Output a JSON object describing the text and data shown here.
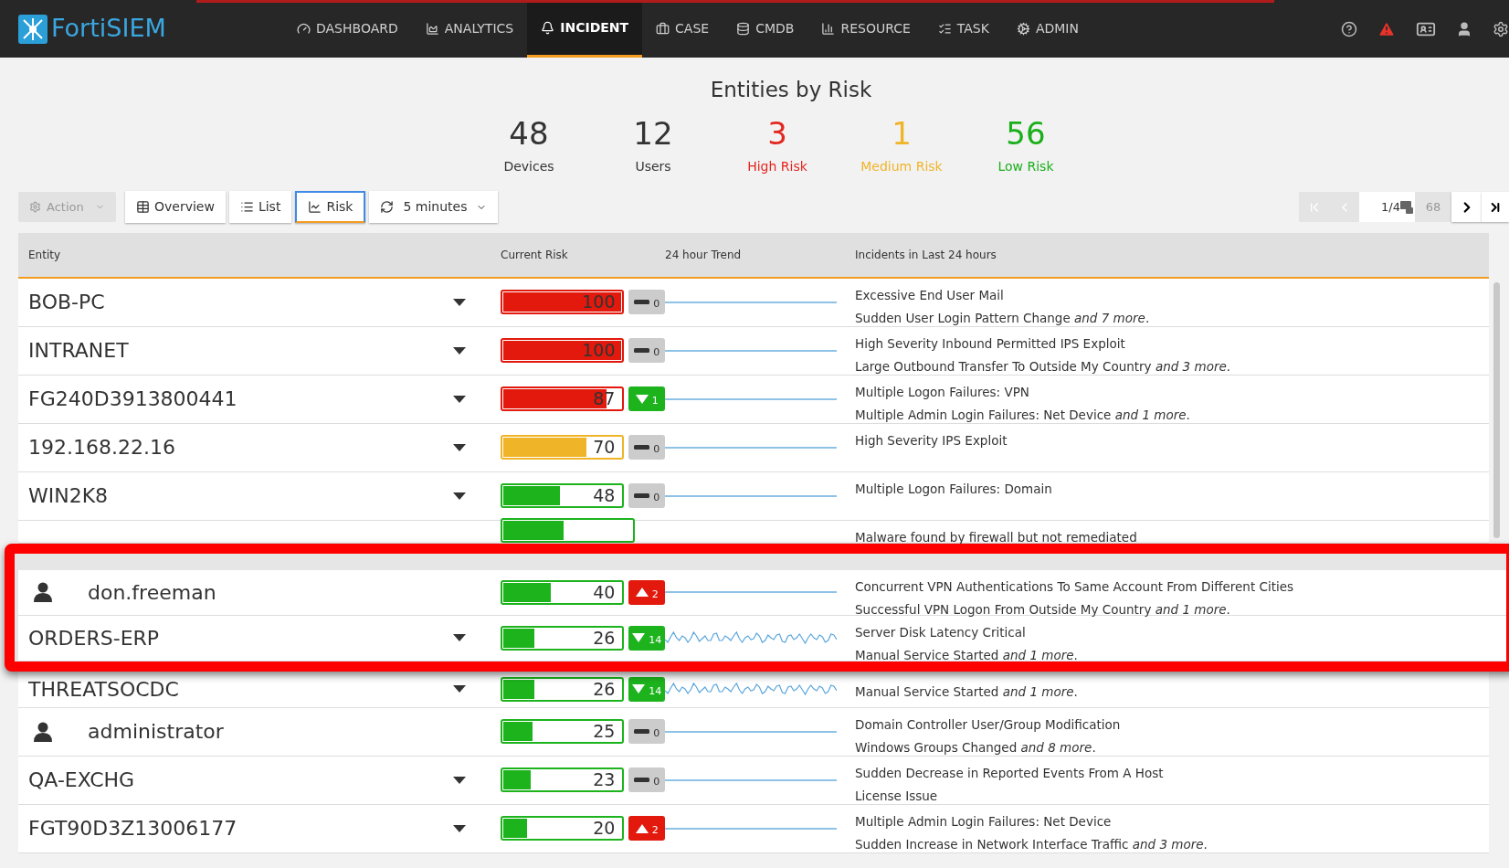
{
  "app": {
    "logo": "FortiSIEM"
  },
  "nav": [
    {
      "label": "DASHBOARD",
      "selected": false
    },
    {
      "label": "ANALYTICS",
      "selected": false
    },
    {
      "label": "INCIDENT",
      "selected": true
    },
    {
      "label": "CASE",
      "selected": false
    },
    {
      "label": "CMDB",
      "selected": false
    },
    {
      "label": "RESOURCE",
      "selected": false
    },
    {
      "label": "TASK",
      "selected": false
    },
    {
      "label": "ADMIN",
      "selected": false
    }
  ],
  "page_title": "Entities by Risk",
  "stats": [
    {
      "value": "48",
      "label": "Devices",
      "color": "#333333"
    },
    {
      "value": "12",
      "label": "Users",
      "color": "#333333"
    },
    {
      "value": "3",
      "label": "High Risk",
      "color": "#e3261f"
    },
    {
      "value": "1",
      "label": "Medium Risk",
      "color": "#f0b429"
    },
    {
      "value": "56",
      "label": "Low Risk",
      "color": "#1aaf1a"
    }
  ],
  "toolbar": {
    "action": {
      "label": "Action",
      "disabled": true
    },
    "views": [
      {
        "label": "Overview",
        "selected": false
      },
      {
        "label": "List",
        "selected": false
      },
      {
        "label": "Risk",
        "selected": true
      }
    ],
    "refresh": "5 minutes"
  },
  "pagination": {
    "page": "1/4",
    "total": "68",
    "first_disabled": true,
    "prev_disabled": true
  },
  "table": {
    "columns": [
      "Entity",
      "Current Risk",
      "24 hour Trend",
      "Incidents in Last 24 hours"
    ],
    "rows": [
      {
        "kind": "device",
        "name": "BOB-PC",
        "risk": {
          "text": "100",
          "level": 1.0,
          "color": "#e2190c"
        },
        "change": {
          "kind": "flat",
          "text": "0"
        },
        "sparkline": {
          "kind": "flat"
        },
        "incidents": [
          "Excessive End User Mail",
          "Sudden User Login Pattern Change *and 7 more*."
        ]
      },
      {
        "kind": "device",
        "name": "INTRANET",
        "risk": {
          "text": "100",
          "level": 1.0,
          "color": "#e2190c"
        },
        "change": {
          "kind": "flat",
          "text": "0"
        },
        "sparkline": {
          "kind": "flat"
        },
        "incidents": [
          "High Severity Inbound Permitted IPS Exploit",
          "Large Outbound Transfer To Outside My Country *and 3 more*."
        ]
      },
      {
        "kind": "device",
        "name": "FG240D3913800441",
        "risk": {
          "text": "87",
          "level": 0.87,
          "color": "#e2190c"
        },
        "change": {
          "kind": "down",
          "text": "1"
        },
        "sparkline": {
          "kind": "flat"
        },
        "incidents": [
          "Multiple Logon Failures: VPN",
          "Multiple Admin Login Failures: Net Device *and 1 more*."
        ]
      },
      {
        "kind": "device",
        "name": "192.168.22.16",
        "risk": {
          "text": "70",
          "level": 0.7,
          "color": "#f0b429"
        },
        "change": {
          "kind": "flat",
          "text": "0"
        },
        "sparkline": {
          "kind": "flat"
        },
        "incidents": [
          "High Severity IPS Exploit"
        ]
      },
      {
        "kind": "device",
        "name": "WIN2K8",
        "risk": {
          "text": "48",
          "level": 0.48,
          "color": "#1db31d"
        },
        "change": {
          "kind": "flat",
          "text": "0"
        },
        "sparkline": {
          "kind": "flat"
        },
        "incidents": [
          "Multiple Logon Failures: Domain"
        ]
      }
    ]
  },
  "partial_row": {
    "risk": {
      "level": 0.47,
      "color": "#1db31d"
    },
    "incidents": [
      "Malware found by firewall but not remediated"
    ]
  },
  "highlight_rows": [
    {
      "kind": "user",
      "name": "don.freeman",
      "risk": {
        "text": "40",
        "level": 0.4,
        "color": "#1db31d"
      },
      "change": {
        "kind": "up",
        "text": "2"
      },
      "sparkline": {
        "kind": "flat"
      },
      "incidents": [
        "Concurrent VPN Authentications To Same Account From Different Cities",
        "Successful VPN Logon From Outside My Country *and 1 more*."
      ]
    },
    {
      "kind": "device",
      "name": "ORDERS-ERP",
      "risk": {
        "text": "26",
        "level": 0.26,
        "color": "#1db31d"
      },
      "change": {
        "kind": "down",
        "text": "14"
      },
      "sparkline": {
        "kind": "noisy"
      },
      "incidents": [
        "Server Disk Latency Critical",
        "Manual Service Started *and 1 more*."
      ]
    }
  ],
  "rows_after": [
    {
      "kind": "device",
      "name": "THREATSOCDC",
      "risk": {
        "text": "26",
        "level": 0.26,
        "color": "#1db31d"
      },
      "change": {
        "kind": "down",
        "text": "14"
      },
      "sparkline": {
        "kind": "noisy"
      },
      "incidents": [
        "Manual Service Started *and 1 more*."
      ]
    },
    {
      "kind": "user",
      "name": "administrator",
      "risk": {
        "text": "25",
        "level": 0.25,
        "color": "#1db31d"
      },
      "change": {
        "kind": "flat",
        "text": "0"
      },
      "sparkline": {
        "kind": "flat"
      },
      "incidents": [
        "Domain Controller User/Group Modification",
        "Windows Groups Changed *and 8 more*."
      ]
    },
    {
      "kind": "device",
      "name": "QA-EXCHG",
      "risk": {
        "text": "23",
        "level": 0.23,
        "color": "#1db31d"
      },
      "change": {
        "kind": "flat",
        "text": "0"
      },
      "sparkline": {
        "kind": "flat"
      },
      "incidents": [
        "Sudden Decrease in Reported Events From A Host",
        "License Issue"
      ]
    },
    {
      "kind": "device",
      "name": "FGT90D3Z13006177",
      "risk": {
        "text": "20",
        "level": 0.2,
        "color": "#1db31d"
      },
      "change": {
        "kind": "up",
        "text": "2"
      },
      "sparkline": {
        "kind": "flat"
      },
      "incidents": [
        "Multiple Admin Login Failures: Net Device",
        "Sudden Increase in Network Interface Traffic *and 3 more*."
      ]
    }
  ]
}
